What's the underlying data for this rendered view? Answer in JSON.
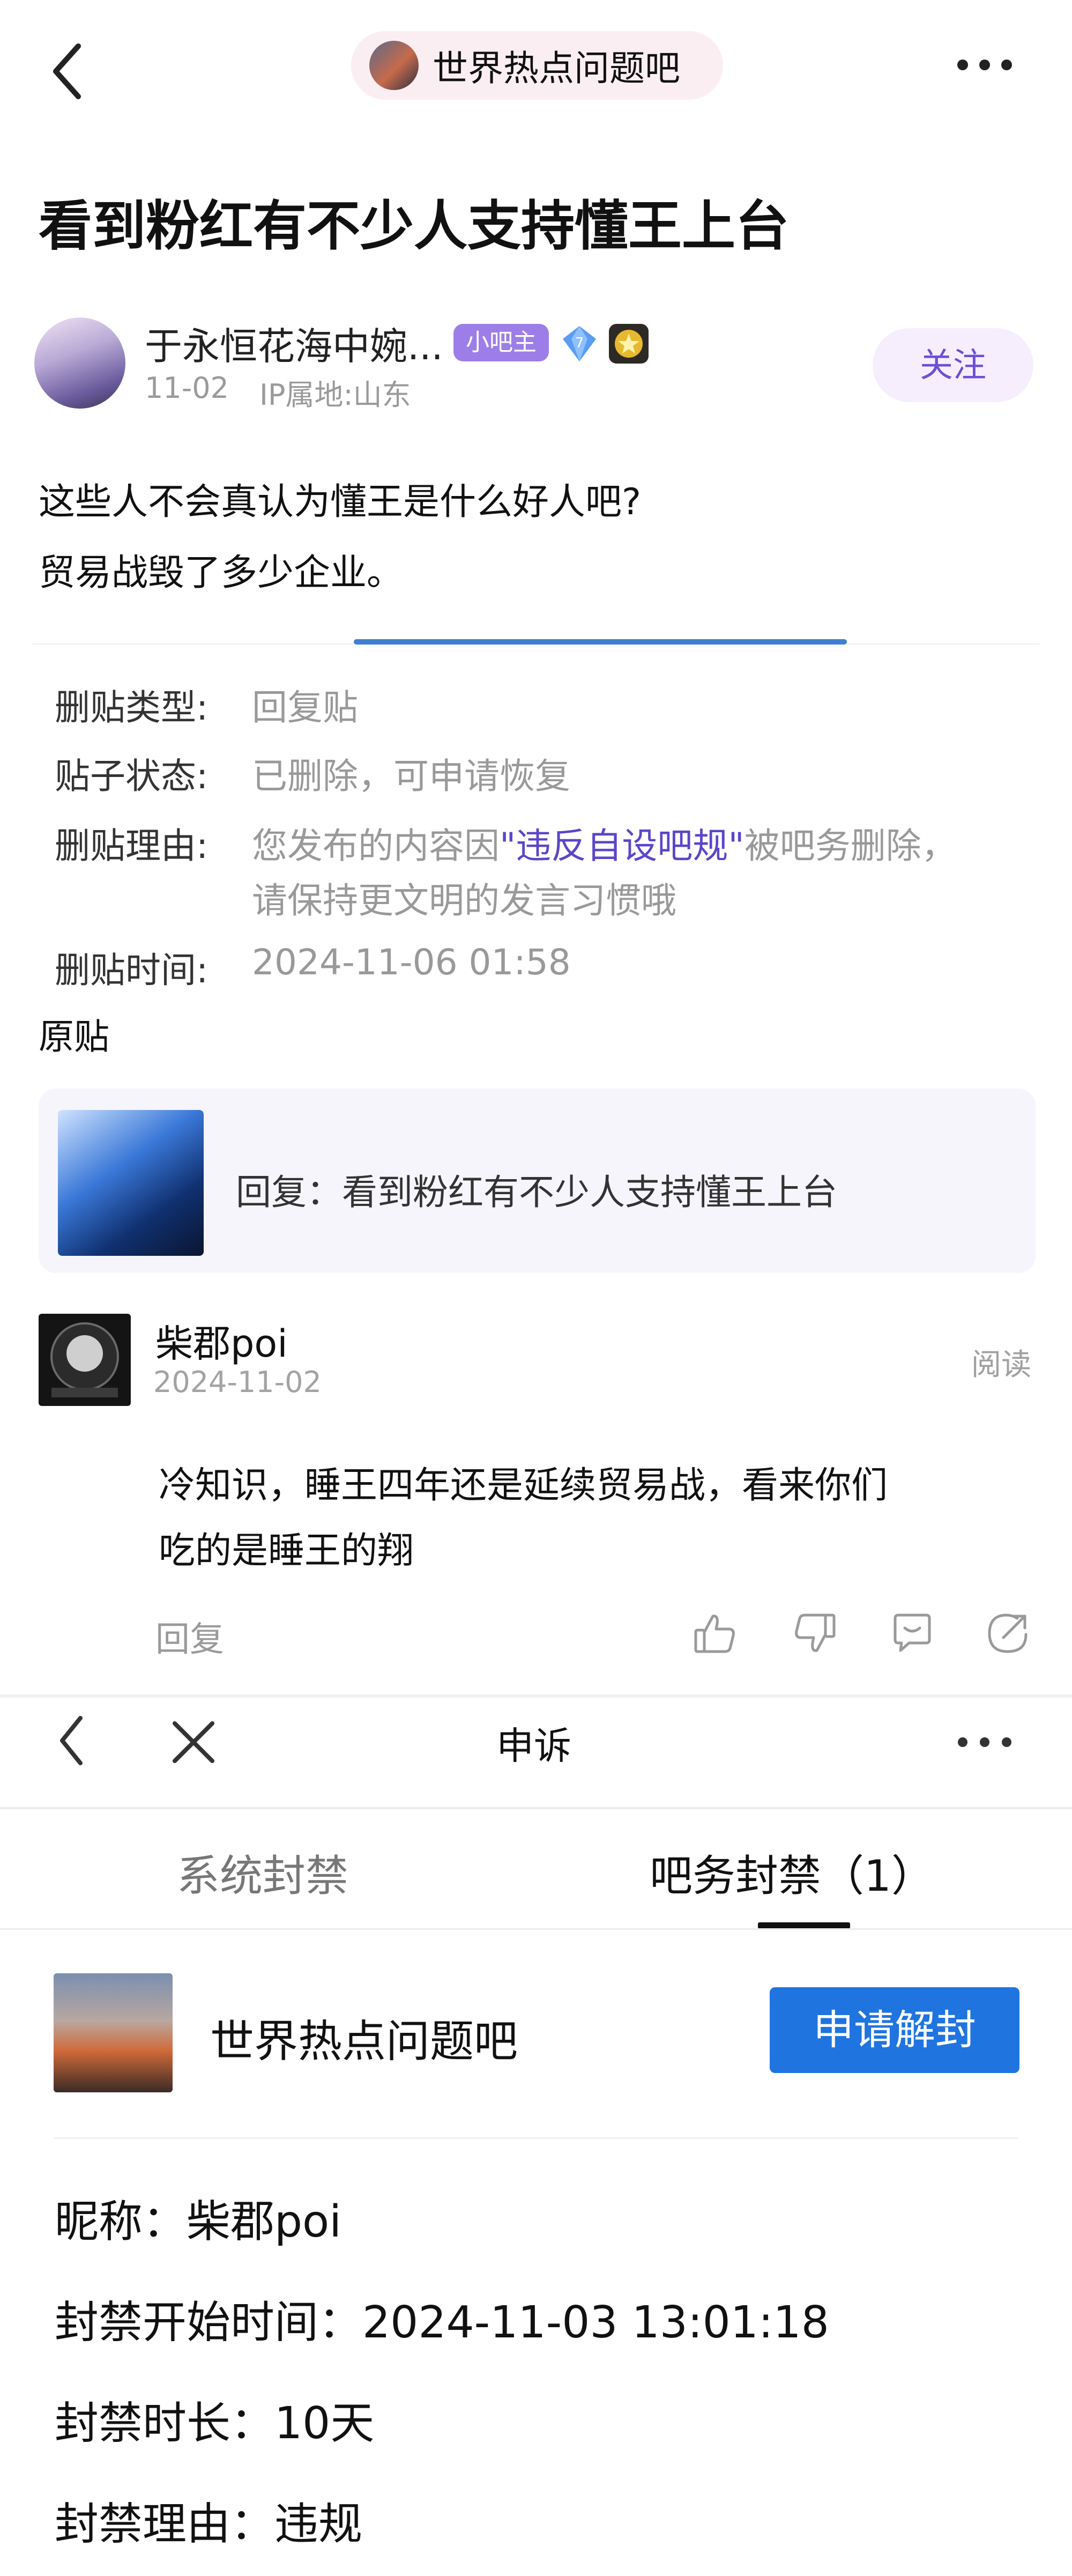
{
  "header": {
    "forum_name": "世界热点问题吧"
  },
  "post": {
    "title": "看到粉红有不少人支持懂王上台",
    "author": {
      "name": "于永恒花海中婉...",
      "badge_owner": "小吧主",
      "level": "7",
      "date": "11-02",
      "ip": "IP属地:山东"
    },
    "follow_label": "关注",
    "body_lines": [
      "这些人不会真认为懂王是什么好人吧?",
      "贸易战毁了多少企业。"
    ]
  },
  "delete_info": {
    "type_label": "删贴类型:",
    "type_value": "回复贴",
    "status_label": "贴子状态:",
    "status_value": "已删除，可申请恢复",
    "reason_label": "删贴理由:",
    "reason_part1": "您发布的内容因",
    "reason_link": "\"违反自设吧规\"",
    "reason_part2": "被吧务删除，",
    "reason_line2": "请保持更文明的发言习惯哦",
    "time_label": "删贴时间:",
    "time_value": "2024-11-06 01:58",
    "original_label": "原贴",
    "quote_text": "回复：看到粉红有不少人支持懂王上台"
  },
  "reply": {
    "name": "柴郡poi",
    "date": "2024-11-02",
    "read_label": "阅读",
    "lines": [
      " 冷知识，睡王四年还是延续贸易战，看来你们",
      "吃的是睡王的翔"
    ],
    "reply_label": "回复"
  },
  "appeal": {
    "nav_title": "申诉",
    "tabs": [
      {
        "label": "系统封禁"
      },
      {
        "label": "吧务封禁（1）"
      }
    ],
    "forum_name": "世界热点问题吧",
    "unban_label": "申请解封",
    "rows": [
      "昵称：柴郡poi",
      "封禁开始时间：2024-11-03 13:01:18",
      "封禁时长：10天",
      "封禁理由：违规"
    ]
  }
}
